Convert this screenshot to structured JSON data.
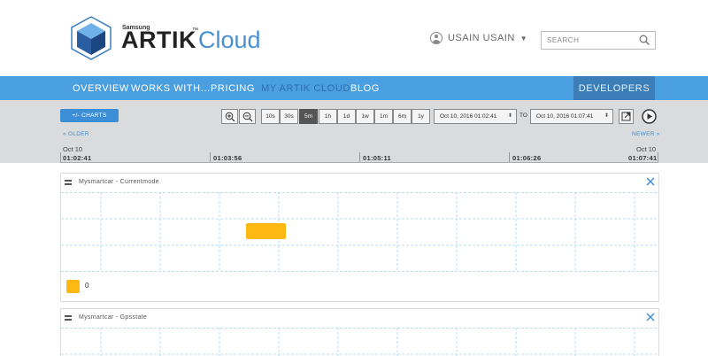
{
  "header": {
    "brand_top": "Samsung",
    "brand_main": "ARTIK",
    "brand_tm": "™",
    "brand_sub": "Cloud",
    "user_name": "USAIN USAIN",
    "search_placeholder": "SEARCH"
  },
  "nav": {
    "items": [
      {
        "label": "OVERVIEW",
        "active": false
      },
      {
        "label": "WORKS WITH...",
        "active": false
      },
      {
        "label": "PRICING",
        "active": false
      },
      {
        "label": "MY ARTIK CLOUD",
        "active": true
      },
      {
        "label": "BLOG",
        "active": false
      }
    ],
    "developers": "DEVELOPERS"
  },
  "toolbar": {
    "charts_button": "+/- CHARTS",
    "ranges": [
      "10s",
      "30s",
      "5m",
      "1h",
      "1d",
      "1w",
      "1m",
      "6m",
      "1y"
    ],
    "selected_range": "5m",
    "from_date": "Oct 10, 2016 01:02:41",
    "to_label": "TO",
    "to_date": "Oct 10, 2016 01:07:41",
    "older": "« OLDER",
    "newer": "NEWER »"
  },
  "timeline": {
    "start_date": "Oct 10",
    "end_date": "Oct 10",
    "ticks": [
      "01:02:41",
      "01:03:56",
      "01:05:11",
      "01:06:26",
      "01:07:41"
    ]
  },
  "charts": [
    {
      "title": "Mysmartcar - Currentmode",
      "legend": [
        {
          "label": "0",
          "color": "#fdb813"
        }
      ]
    },
    {
      "title": "Mysmartcar - Gpsstate"
    }
  ],
  "colors": {
    "nav_bg": "#4a9fe0",
    "developers_bg": "#3c7fb8",
    "accent": "#3c8ed6",
    "series": "#fdb813"
  }
}
